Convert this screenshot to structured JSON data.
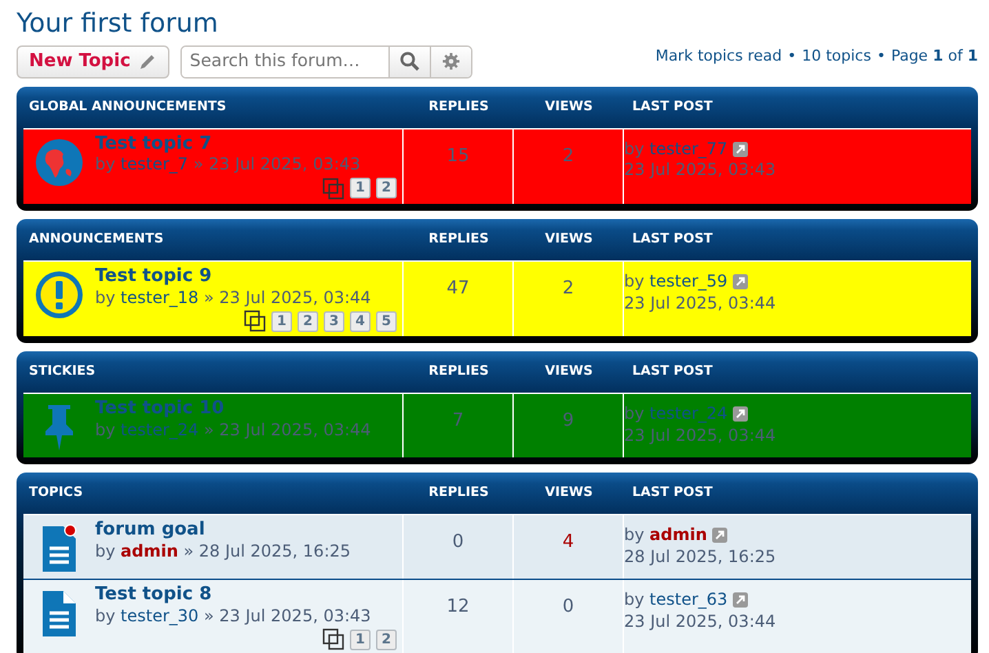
{
  "forum_title": "Your first forum",
  "toolbar": {
    "new_topic": "New Topic",
    "search": {
      "placeholder": "Search this forum…"
    },
    "mark_read": "Mark topics read",
    "topic_count": "10 topics",
    "page_label": "Page",
    "page_current": "1",
    "page_of": "of",
    "page_total": "1",
    "separator": "•"
  },
  "sections": [
    {
      "title": "GLOBAL ANNOUNCEMENTS",
      "columns": [
        "REPLIES",
        "VIEWS",
        "LAST POST"
      ],
      "topics": [
        {
          "kind": "global",
          "color": "#ff0000",
          "title": "Test topic 7",
          "by": "by",
          "author": "tester_7",
          "author_highlighted": false,
          "views_highlighted": false,
          "last_author_highlighted": false,
          "sep": "»",
          "date": "23 Jul 2025, 03:43",
          "pages": [
            "1",
            "2"
          ],
          "replies": "15",
          "views": "2",
          "last_by": "by",
          "last_author": "tester_77",
          "last_date": "23 Jul 2025, 03:43"
        }
      ]
    },
    {
      "title": "ANNOUNCEMENTS",
      "columns": [
        "REPLIES",
        "VIEWS",
        "LAST POST"
      ],
      "topics": [
        {
          "kind": "announce",
          "color": "#ffff00",
          "title": "Test topic 9",
          "by": "by",
          "author": "tester_18",
          "author_highlighted": false,
          "views_highlighted": false,
          "last_author_highlighted": false,
          "sep": "»",
          "date": "23 Jul 2025, 03:44",
          "pages": [
            "1",
            "2",
            "3",
            "4",
            "5"
          ],
          "replies": "47",
          "views": "2",
          "last_by": "by",
          "last_author": "tester_59",
          "last_date": "23 Jul 2025, 03:44"
        }
      ]
    },
    {
      "title": "STICKIES",
      "columns": [
        "REPLIES",
        "VIEWS",
        "LAST POST"
      ],
      "topics": [
        {
          "kind": "sticky",
          "color": "#008000",
          "title": "Test topic 10",
          "by": "by",
          "author": "tester_24",
          "author_highlighted": false,
          "views_highlighted": false,
          "last_author_highlighted": false,
          "sep": "»",
          "date": "23 Jul 2025, 03:44",
          "replies": "7",
          "views": "9",
          "last_by": "by",
          "last_author": "tester_24",
          "last_date": "23 Jul 2025, 03:44"
        }
      ]
    },
    {
      "title": "TOPICS",
      "columns": [
        "REPLIES",
        "VIEWS",
        "LAST POST"
      ],
      "topics": [
        {
          "kind": "unread",
          "color": "#e1ebf2",
          "title": "forum goal",
          "by": "by",
          "author": "admin",
          "author_highlighted": true,
          "views_highlighted": true,
          "last_author_highlighted": true,
          "sep": "»",
          "date": "28 Jul 2025, 16:25",
          "replies": "0",
          "views": "4",
          "last_by": "by",
          "last_author": "admin",
          "last_date": "28 Jul 2025, 16:25"
        },
        {
          "kind": "read",
          "color": "#ecf3f7",
          "title": "Test topic 8",
          "by": "by",
          "author": "tester_30",
          "author_highlighted": false,
          "views_highlighted": false,
          "last_author_highlighted": false,
          "sep": "»",
          "date": "23 Jul 2025, 03:43",
          "pages": [
            "1",
            "2"
          ],
          "replies": "12",
          "views": "0",
          "last_by": "by",
          "last_author": "tester_63",
          "last_date": "23 Jul 2025, 03:44"
        }
      ]
    }
  ]
}
